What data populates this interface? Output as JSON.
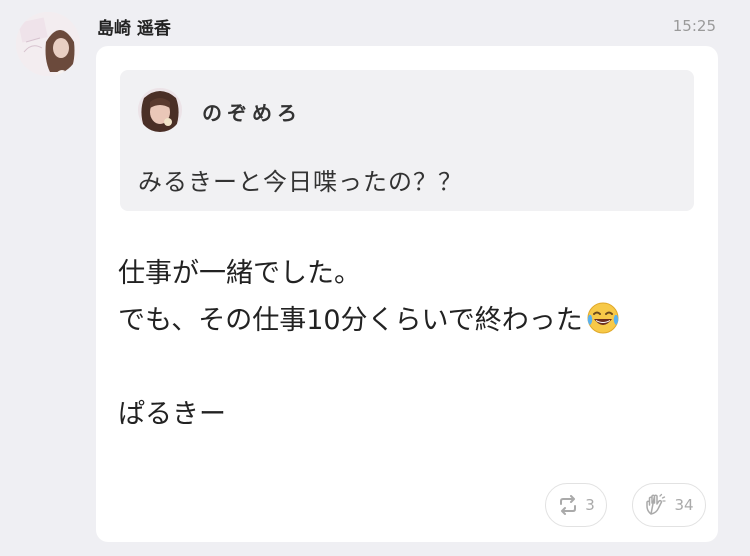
{
  "message": {
    "sender_name": "島崎 遥香",
    "time": "15:25",
    "quote": {
      "author": "のぞめろ",
      "text": "みるきーと今日喋ったの？？"
    },
    "lines": [
      "仕事が一緒でした。",
      "でも、その仕事10分くらいで終わった",
      "",
      "ぱるきー"
    ],
    "emoji": "face-with-tears-of-joy",
    "actions": {
      "retweet_count": "3",
      "clap_count": "34"
    }
  },
  "colors": {
    "background": "#efeff3",
    "bubble": "#ffffff",
    "quote_background": "#f1f1f3",
    "timestamp": "#9a9a9a",
    "action_icon": "#aaaaaa"
  }
}
